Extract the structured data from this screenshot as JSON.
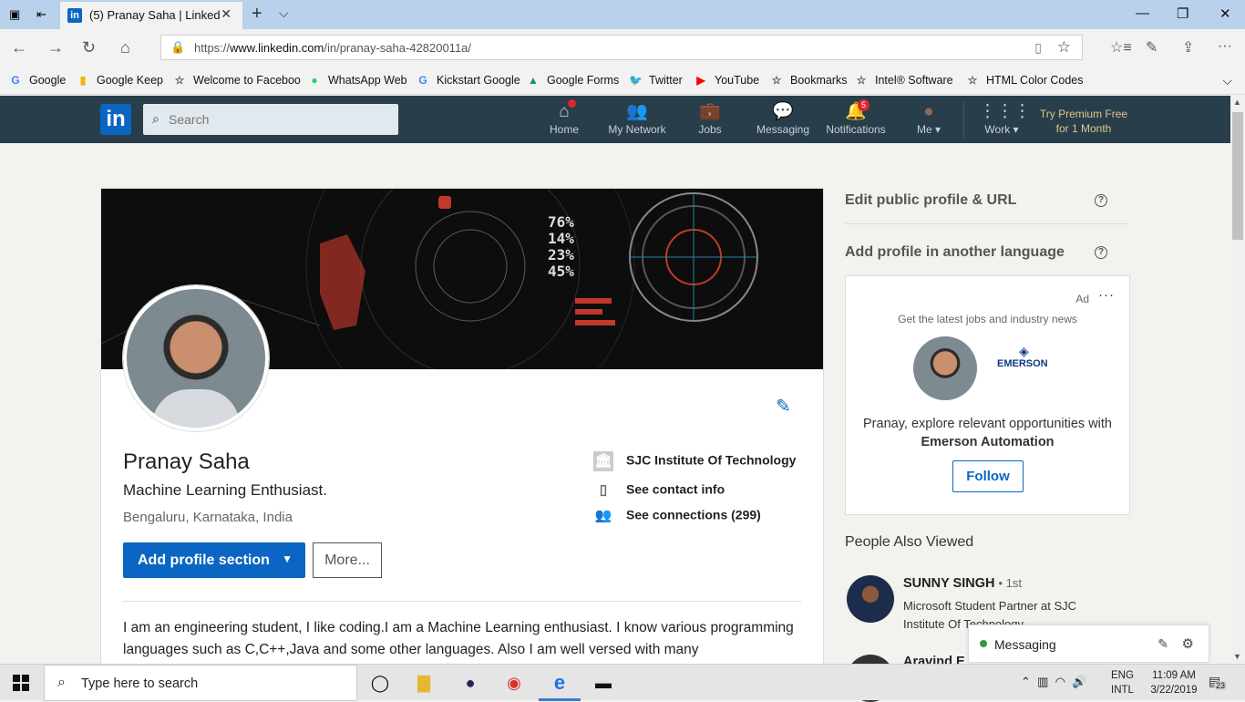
{
  "browser": {
    "tab_title": "(5) Pranay Saha | Linked",
    "url_prefix": "https://",
    "url_domain": "www.linkedin.com",
    "url_path": "/in/pranay-saha-42820011a/",
    "favorites": [
      {
        "label": "Google",
        "icon": "google-icon",
        "glyph": "G",
        "color": "#4285f4"
      },
      {
        "label": "Google Keep",
        "icon": "keep-icon",
        "glyph": "▮",
        "color": "#f4b400"
      },
      {
        "label": "Welcome to Faceboo",
        "icon": "star-icon",
        "glyph": "☆",
        "color": "#555"
      },
      {
        "label": "WhatsApp Web",
        "icon": "whatsapp-icon",
        "glyph": "●",
        "color": "#25d366"
      },
      {
        "label": "Kickstart Google",
        "icon": "google-icon",
        "glyph": "G",
        "color": "#4285f4"
      },
      {
        "label": "Google Forms",
        "icon": "drive-icon",
        "glyph": "▲",
        "color": "#0f9d58"
      },
      {
        "label": "Twitter",
        "icon": "twitter-icon",
        "glyph": "🐦",
        "color": "#1da1f2"
      },
      {
        "label": "YouTube",
        "icon": "youtube-icon",
        "glyph": "▶",
        "color": "#ff0000"
      },
      {
        "label": "Bookmarks",
        "icon": "star-icon",
        "glyph": "☆",
        "color": "#555"
      },
      {
        "label": "Intel® Software",
        "icon": "star-icon",
        "glyph": "☆",
        "color": "#555"
      },
      {
        "label": "HTML Color Codes",
        "icon": "star-icon",
        "glyph": "☆",
        "color": "#555"
      }
    ]
  },
  "linkedin": {
    "logo": "in",
    "search_placeholder": "Search",
    "nav": [
      {
        "label": "Home",
        "icon": "home-icon",
        "glyph": "⌂",
        "badge": ""
      },
      {
        "label": "My Network",
        "icon": "network-icon",
        "glyph": "👥",
        "badge": ""
      },
      {
        "label": "Jobs",
        "icon": "briefcase-icon",
        "glyph": "💼",
        "badge": ""
      },
      {
        "label": "Messaging",
        "icon": "messaging-icon",
        "glyph": "💬",
        "badge": ""
      },
      {
        "label": "Notifications",
        "icon": "bell-icon",
        "glyph": "🔔",
        "badge": "5"
      },
      {
        "label": "Me ▾",
        "icon": "avatar-icon",
        "glyph": "●",
        "badge": ""
      },
      {
        "label": "Work ▾",
        "icon": "grid-icon",
        "glyph": "⋮⋮⋮",
        "badge": ""
      }
    ],
    "premium": "Try Premium Free for 1 Month"
  },
  "profile": {
    "name": "Pranay Saha",
    "headline": "Machine Learning Enthusiast.",
    "location": "Bengaluru, Karnataka, India",
    "school": "SJC Institute Of Technology",
    "contact": "See contact info",
    "connections": "See connections (299)",
    "add_section": "Add profile section",
    "more": "More...",
    "about": "I am an engineering student, I like coding.I am a Machine Learning enthusiast. I know various programming languages such as C,C++,Java and some other languages. Also I am well versed with many"
  },
  "sidebar": {
    "edit_url": "Edit public profile & URL",
    "add_language": "Add profile in another language",
    "ad": {
      "label": "Ad",
      "tagline": "Get the latest jobs and industry news",
      "company": "EMERSON",
      "message_prefix": "Pranay, explore relevant opportunities with",
      "message_company": "Emerson Automation",
      "follow": "Follow"
    },
    "people_title": "People Also Viewed",
    "people": [
      {
        "name": "SUNNY SINGH",
        "degree": "• 1st",
        "headline": "Microsoft Student Partner at SJC Institute Of Technology"
      },
      {
        "name": "Aravind E",
        "degree": "",
        "headline": ""
      }
    ]
  },
  "messaging": {
    "label": "Messaging"
  },
  "taskbar": {
    "search_placeholder": "Type here to search",
    "lang_top": "ENG",
    "lang_bottom": "INTL",
    "time": "11:09 AM",
    "date": "3/22/2019",
    "notifications": "23"
  }
}
